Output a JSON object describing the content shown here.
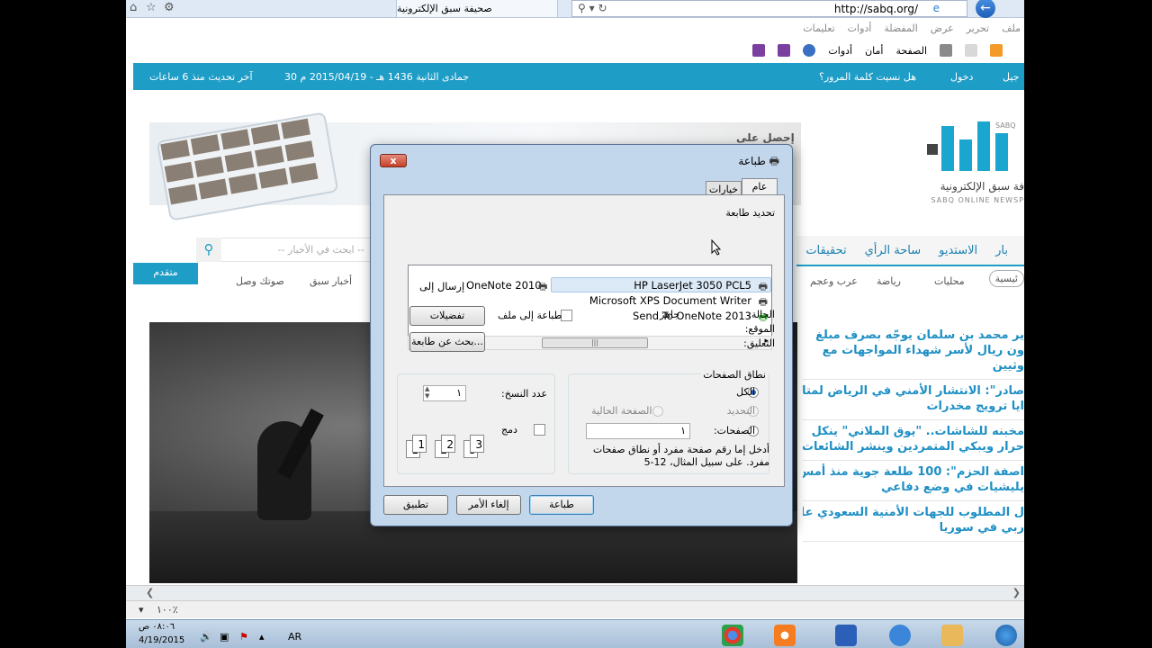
{
  "browser": {
    "tab_title": "صحيفة سبق الإلكترونية",
    "address": "http://sabq.org/",
    "menu": [
      "ملف",
      "تحرير",
      "عرض",
      "المفضلة",
      "أدوات",
      "تعليمات"
    ],
    "cmd": {
      "page": "الصفحة",
      "safety": "أمان",
      "tools": "أدوات"
    }
  },
  "site": {
    "login": "دخول",
    "forgot_password": "هل نسيت كلمة المرور؟",
    "date": "30 جمادى الثانية 1436 هـ - 2015/04/19 م",
    "last_update": "آخر تحديث منذ 6 ساعات",
    "register_fragment": "جيل",
    "ad_text": "إحصل على",
    "logo_caption_ar": "فة سبق الإلكترونية",
    "logo_caption_en": "SABQ ONLINE NEWSP",
    "logo_mark": "SABQ",
    "search_placeholder": "-- ابحث في الأخبار --",
    "nav": [
      "بار",
      "الاستديو",
      "ساحة الرأي",
      "تحقيقات"
    ],
    "advanced_label": "متقدم",
    "subnav": [
      "ئيسية",
      "محليات",
      "رياضة",
      "عرب وعجم",
      "أخبار سبق",
      "صوتك وصل"
    ],
    "headlines": [
      "ير محمد بن سلمان يوجّه بصرف مبلغ",
      "ون ريال لأسر شهداء المواجهات مع",
      "وثيين",
      "صادر\": الانتشار الأمني في الرياض لمتابعة",
      "ايا ترويج مخدرات",
      "مخبنه للشاشات.. \"يوق الملاني\" ينكل",
      "حرار ويبكي المتمردين وينشر الشائعات!",
      "اصفة الحزم\": 100 طلعة جوية منذ أمس..",
      "يليشيات في وضع دفاعي",
      "ل المطلوب للجهات الأمنية السعودي عادل",
      "ربي في سوريا"
    ]
  },
  "status": {
    "zoom": "١٠٠٪"
  },
  "taskbar": {
    "time": "٠٨:٠٦ ص",
    "date": "4/19/2015",
    "lang": "AR"
  },
  "dialog": {
    "title": "طباعة",
    "close": "x",
    "tabs": [
      "عام",
      "خيارات"
    ],
    "select_printer": "تحديد طابعة",
    "printers": [
      "HP LaserJet 3050 PCL5",
      "Microsoft XPS Document Writer",
      "Send To OneNote 2013",
      "OneNote 2010",
      "إرسال إلى"
    ],
    "status_label": "الحالة:",
    "status_value": "جاهز",
    "location_label": "الموقع:",
    "comment_label": "التعليق:",
    "print_to_file": "طباعة إلى ملف",
    "preferences": "تفضيلات",
    "find_printer": "بحث عن طابعة...",
    "page_range": "نطاق الصفحات",
    "range_all": "الكل",
    "range_selection": "التحديد",
    "range_current": "الصفحة الحالية",
    "range_pages": "الصفحات:",
    "pages_value": "١",
    "pages_hint_1": "أدخل إما رقم صفحة مفرد أو نطاق صفحات",
    "pages_hint_2": "مفرد. على سبيل المثال، 12-5",
    "copies_label": "عدد النسخ:",
    "copies_value": "١",
    "collate": "دمج",
    "collate_pages": [
      "1",
      "1",
      "2",
      "2",
      "3",
      "3"
    ],
    "btn_print": "طباعة",
    "btn_cancel": "إلغاء الأمر",
    "btn_apply": "تطبيق"
  }
}
